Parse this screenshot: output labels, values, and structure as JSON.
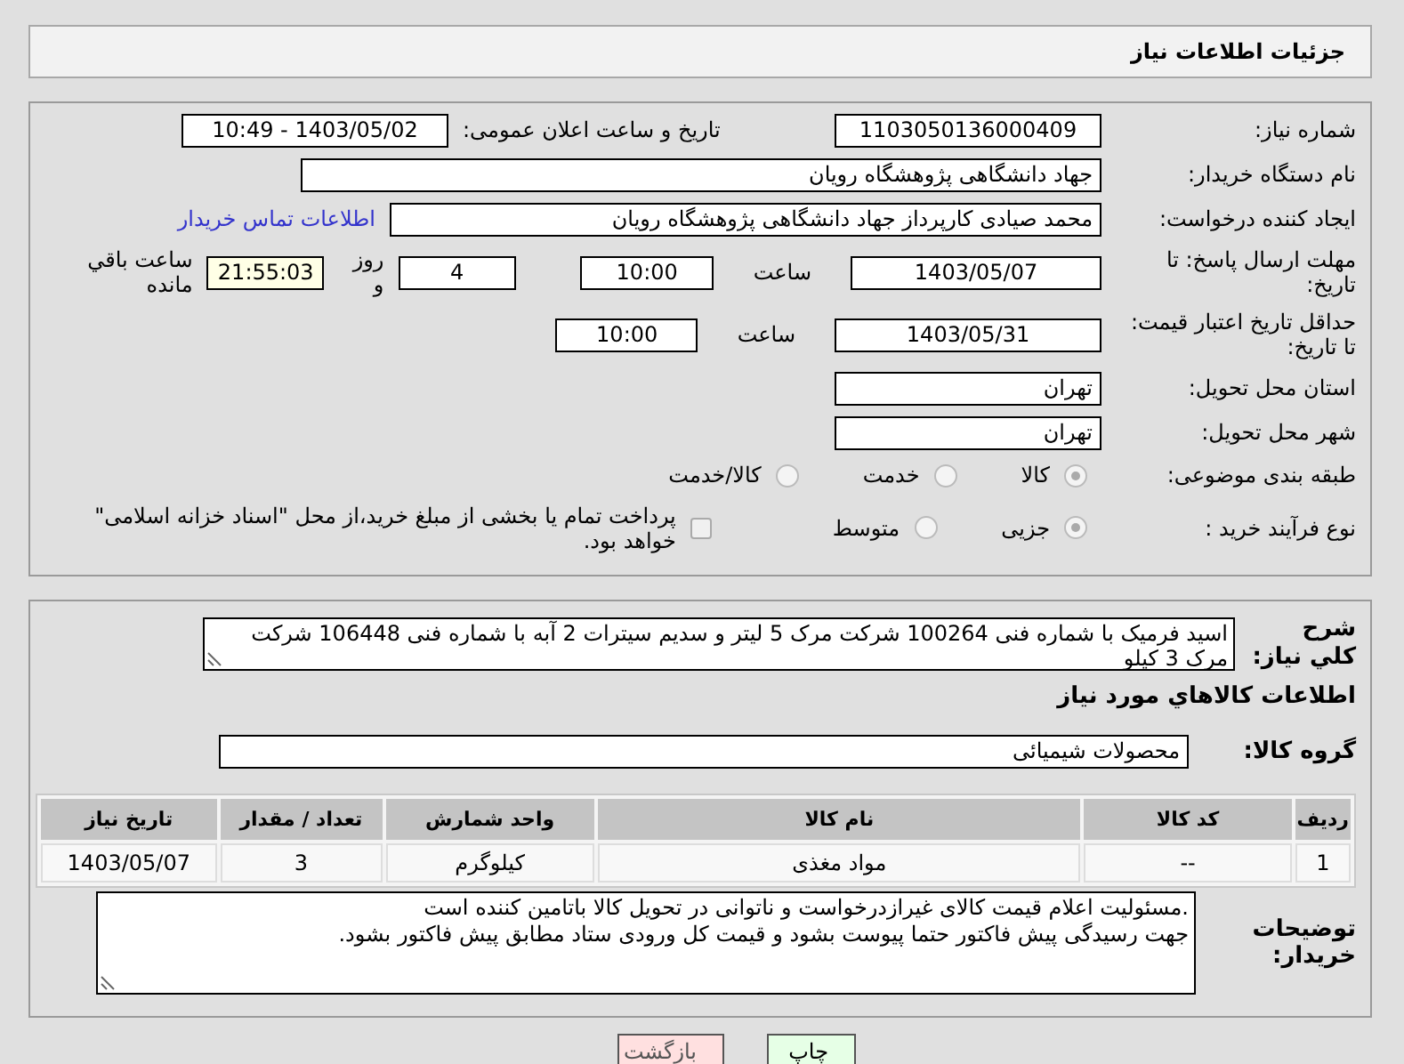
{
  "header": {
    "title": "جزئیات اطلاعات نیاز"
  },
  "need_number": {
    "label": "شماره نیاز:",
    "value": "1103050136000409"
  },
  "announce": {
    "label": "تاریخ و ساعت اعلان عمومی:",
    "value": "1403/05/02 - 10:49"
  },
  "buyer_org": {
    "label": "نام دستگاه خریدار:",
    "value": "جهاد دانشگاهی پژوهشگاه رویان"
  },
  "requester": {
    "label": "ایجاد کننده درخواست:",
    "value": "محمد صیادی کارپرداز جهاد دانشگاهی پژوهشگاه رویان",
    "link": "اطلاعات تماس خریدار"
  },
  "reply_deadline": {
    "label": "مهلت ارسال پاسخ: تا تاریخ:",
    "date": "1403/05/07",
    "time_label": "ساعت",
    "time": "10:00",
    "days": "4",
    "days_label": "روز و",
    "remaining": "21:55:03",
    "remaining_label": "ساعت باقي مانده"
  },
  "price_validity": {
    "label": "حداقل تاریخ اعتبار قیمت: تا تاریخ:",
    "date": "1403/05/31",
    "time_label": "ساعت",
    "time": "10:00"
  },
  "province": {
    "label": "استان محل تحویل:",
    "value": "تهران"
  },
  "city": {
    "label": "شهر محل تحویل:",
    "value": "تهران"
  },
  "category": {
    "label": "طبقه بندی موضوعی:",
    "options": [
      {
        "label": "کالا",
        "selected": true
      },
      {
        "label": "خدمت",
        "selected": false
      },
      {
        "label": "کالا/خدمت",
        "selected": false
      }
    ]
  },
  "purchase_type": {
    "label": "نوع فرآیند خرید :",
    "options": [
      {
        "label": "جزیی",
        "selected": true
      },
      {
        "label": "متوسط",
        "selected": false
      }
    ],
    "payment": {
      "checked": false,
      "text": "پرداخت تمام یا بخشی از مبلغ خرید،از محل \"اسناد خزانه اسلامی\" خواهد بود."
    }
  },
  "description": {
    "label": "شرح کلي نياز:",
    "value": "اسید فرمیک با شماره فنی 100264 شرکت مرک 5 لیتر و سدیم سیترات 2 آبه با شماره فنی 106448 شرکت مرک 3 کیلو"
  },
  "goods_heading": "اطلاعات کالاهاي مورد نياز",
  "goods_group": {
    "label": "گروه کالا:",
    "value": "محصولات شیمیائی"
  },
  "table": {
    "columns": [
      "ردیف",
      "کد کالا",
      "نام کالا",
      "واحد شمارش",
      "تعداد / مقدار",
      "تاریخ نیاز"
    ],
    "rows": [
      [
        "1",
        "--",
        "مواد مغذی",
        "کیلوگرم",
        "3",
        "1403/05/07"
      ]
    ]
  },
  "buyer_notes": {
    "label": "توضیحات خریدار:",
    "value": ".مسئولیت اعلام قیمت کالای غیرازدرخواست و ناتوانی در تحویل کالا باتامین کننده است\nجهت رسیدگی پیش فاکتور حتما پیوست بشود و قیمت کل ورودی ستاد مطابق پیش فاکتور بشود."
  },
  "buttons": [
    {
      "label": "چاپ",
      "kind": "print"
    },
    {
      "label": "بازگشت",
      "kind": "back"
    }
  ]
}
